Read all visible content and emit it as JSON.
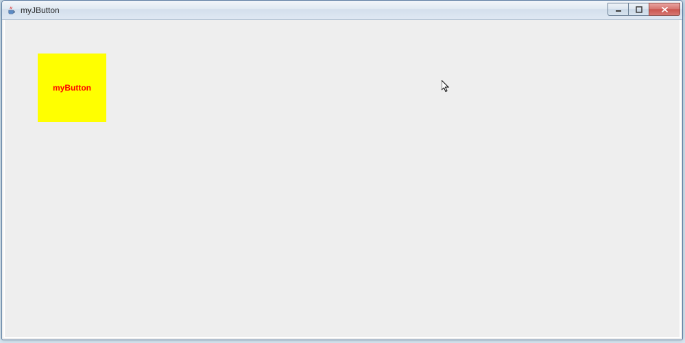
{
  "window": {
    "title": "myJButton"
  },
  "button": {
    "label": "myButton",
    "background_color": "#ffff00",
    "foreground_color": "#ff0000"
  },
  "icons": {
    "minimize": "minimize",
    "maximize": "maximize",
    "close": "close",
    "app": "java-cup"
  }
}
